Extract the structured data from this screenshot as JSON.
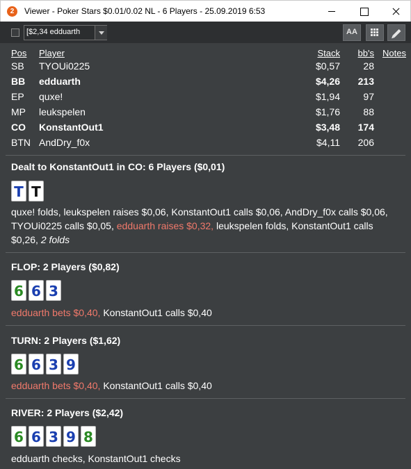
{
  "window": {
    "app_icon_text": "2",
    "title": "Viewer - Poker Stars $0.01/0.02 NL - 6 Players - 25.09.2019 6:53"
  },
  "toolbar": {
    "player_select_value": "[$2,34 edduarth",
    "font_button_label": "AA"
  },
  "table": {
    "headers": {
      "pos": "Pos",
      "player": "Player",
      "stack": "Stack",
      "bbs": "bb's",
      "notes": "Notes"
    },
    "rows": [
      {
        "pos": "SB",
        "player": "TYOUi0225",
        "stack": "$0,57",
        "bbs": "28",
        "bold": false
      },
      {
        "pos": "BB",
        "player": "edduarth",
        "stack": "$4,26",
        "bbs": "213",
        "bold": true
      },
      {
        "pos": "EP",
        "player": "quxe!",
        "stack": "$1,94",
        "bbs": "97",
        "bold": false
      },
      {
        "pos": "MP",
        "player": "leukspelen",
        "stack": "$1,76",
        "bbs": "88",
        "bold": false
      },
      {
        "pos": "CO",
        "player": "KonstantOut1",
        "stack": "$3,48",
        "bbs": "174",
        "bold": true
      },
      {
        "pos": "BTN",
        "player": "AndDry_f0x",
        "stack": "$4,11",
        "bbs": "206",
        "bold": false
      }
    ]
  },
  "colors": {
    "background": "#3c3f41",
    "hero_action": "#f0796b",
    "suit_spades": "#111111",
    "suit_hearts": "#d9271f",
    "suit_diamonds": "#1a3fb0",
    "suit_clubs": "#2a8a23"
  },
  "streets": {
    "preflop": {
      "title": "Dealt to KonstantOut1 in CO: 6 Players ($0,01)",
      "cards": [
        {
          "rank": "T",
          "suit": "diamonds"
        },
        {
          "rank": "T",
          "suit": "spades"
        }
      ],
      "actions": [
        {
          "text": "quxe! folds, leukspelen raises $0,06, KonstantOut1 calls $0,06, AndDry_f0x calls $0,06, TYOUi0225 calls $0,05, ",
          "style": "normal"
        },
        {
          "text": "edduarth raises $0,32,",
          "style": "hero"
        },
        {
          "text": " leukspelen folds, KonstantOut1 calls $0,26, ",
          "style": "normal"
        },
        {
          "text": "2 folds",
          "style": "italic"
        }
      ]
    },
    "flop": {
      "title": "FLOP: 2 Players ($0,82)",
      "cards": [
        {
          "rank": "6",
          "suit": "clubs"
        },
        {
          "rank": "6",
          "suit": "diamonds"
        },
        {
          "rank": "3",
          "suit": "diamonds"
        }
      ],
      "actions": [
        {
          "text": "edduarth bets $0,40,",
          "style": "hero"
        },
        {
          "text": " KonstantOut1 calls $0,40",
          "style": "normal"
        }
      ]
    },
    "turn": {
      "title": "TURN: 2 Players ($1,62)",
      "cards": [
        {
          "rank": "6",
          "suit": "clubs"
        },
        {
          "rank": "6",
          "suit": "diamonds"
        },
        {
          "rank": "3",
          "suit": "diamonds"
        },
        {
          "rank": "9",
          "suit": "diamonds"
        }
      ],
      "actions": [
        {
          "text": "edduarth bets $0,40,",
          "style": "hero"
        },
        {
          "text": " KonstantOut1 calls $0,40",
          "style": "normal"
        }
      ]
    },
    "river": {
      "title": "RIVER: 2 Players ($2,42)",
      "cards": [
        {
          "rank": "6",
          "suit": "clubs"
        },
        {
          "rank": "6",
          "suit": "diamonds"
        },
        {
          "rank": "3",
          "suit": "diamonds"
        },
        {
          "rank": "9",
          "suit": "diamonds"
        },
        {
          "rank": "8",
          "suit": "clubs"
        }
      ],
      "actions": [
        {
          "text": "edduarth checks, KonstantOut1 checks",
          "style": "normal"
        }
      ]
    }
  }
}
